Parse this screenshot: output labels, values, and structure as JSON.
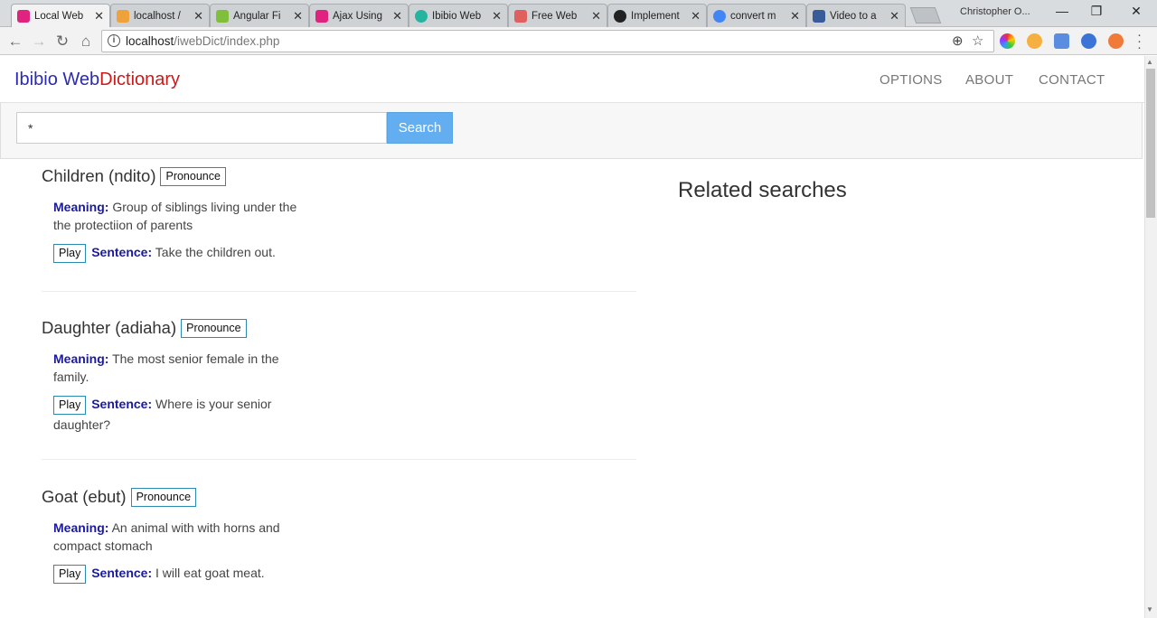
{
  "browser": {
    "tabs": [
      {
        "title": "Local Web",
        "color": "#e0237e",
        "active": true
      },
      {
        "title": "localhost /",
        "color": "#f0a23a",
        "active": false
      },
      {
        "title": "Angular Fi",
        "color": "#7fbf3a",
        "active": false
      },
      {
        "title": "Ajax Using",
        "color": "#e0237e",
        "active": false
      },
      {
        "title": "Ibibio Web",
        "color": "#25b59e",
        "active": false
      },
      {
        "title": "Free Web",
        "color": "#e06060",
        "active": false
      },
      {
        "title": "Implement",
        "color": "#222222",
        "active": false
      },
      {
        "title": "convert m",
        "color": "#4285f4",
        "active": false
      },
      {
        "title": "Video to a",
        "color": "#3a5b9a",
        "active": false
      }
    ],
    "profile_name": "Christopher O...",
    "url_host": "localhost",
    "url_path": "/iwebDict/index.php"
  },
  "navbar": {
    "brand_part1": "Ibibio Web",
    "brand_part2": "Dictionary",
    "links": [
      "OPTIONS",
      "ABOUT",
      "CONTACT"
    ]
  },
  "search": {
    "value": "*",
    "button_label": "Search"
  },
  "entries": [
    {
      "word": "Children (ndito)",
      "pronounce_label": "Pronounce",
      "meaning_label": "Meaning:",
      "meaning": "Group of siblings living under the the protectiion of parents",
      "play_label": "Play",
      "sentence_label": "Sentence:",
      "sentence": "Take the children out."
    },
    {
      "word": "Daughter (adiaha)",
      "pronounce_label": "Pronounce",
      "meaning_label": "Meaning:",
      "meaning": "The most senior female in the family.",
      "play_label": "Play",
      "sentence_label": "Sentence:",
      "sentence": "Where is your senior daughter?"
    },
    {
      "word": "Goat (ebut)",
      "pronounce_label": "Pronounce",
      "meaning_label": "Meaning:",
      "meaning": "An animal with with horns and compact stomach",
      "play_label": "Play",
      "sentence_label": "Sentence:",
      "sentence": "I will eat goat meat."
    }
  ],
  "related": {
    "title": "Related searches"
  },
  "colors": {
    "brand_blue": "#2a2ab5",
    "brand_red": "#d01818",
    "search_button": "#62aef0",
    "label_blue": "#1a1aa0"
  }
}
